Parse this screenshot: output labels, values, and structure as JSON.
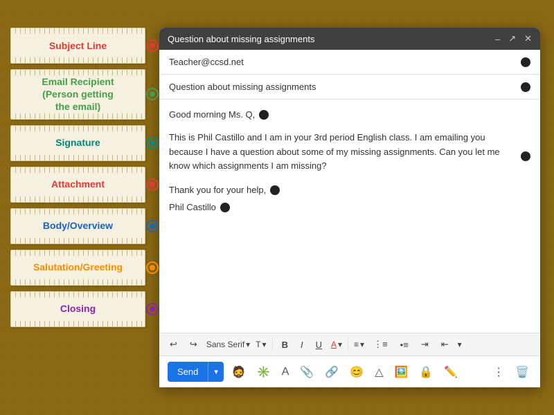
{
  "window": {
    "title": "Question about missing assignments",
    "controls": [
      "–",
      "↗",
      "✕"
    ]
  },
  "email": {
    "to": "Teacher@ccsd.net",
    "subject": "Question about missing assignments",
    "salutation": "Good morning Ms. Q,",
    "body_paragraph": "This is Phil Castillo and I am in your 3rd period English class. I am emailing you because I have a question about some of my missing assignments. Can you let me know which assignments I am missing?",
    "closing_line": "Thank you for your help,",
    "signature": "Phil Castillo"
  },
  "toolbar": {
    "font": "Sans Serif",
    "undo_label": "↩",
    "redo_label": "↪",
    "bold_label": "B",
    "italic_label": "I",
    "underline_label": "U",
    "font_color_label": "A",
    "align_label": "≡",
    "numbered_label": "⋮≡",
    "bulleted_label": "•≡",
    "indent_label": "⇥",
    "outdent_label": "⇤"
  },
  "actions": {
    "send_label": "Send",
    "send_dropdown_label": "▾"
  },
  "sidebar": {
    "notes": [
      {
        "label": "Subject Line",
        "color": "red",
        "dot_class": "dot-red"
      },
      {
        "label": "Email Recipient\n(Person getting\nthe email)",
        "color": "green",
        "dot_class": "dot-green"
      },
      {
        "label": "Signature",
        "color": "teal",
        "dot_class": "dot-teal"
      },
      {
        "label": "Attachment",
        "color": "red",
        "dot_class": "dot-red"
      },
      {
        "label": "Body/Overview",
        "color": "blue",
        "dot_class": "dot-blue"
      },
      {
        "label": "Salutation/Greeting",
        "color": "orange",
        "dot_class": "dot-orange"
      },
      {
        "label": "Closing",
        "color": "purple",
        "dot_class": "dot-purple"
      }
    ]
  }
}
